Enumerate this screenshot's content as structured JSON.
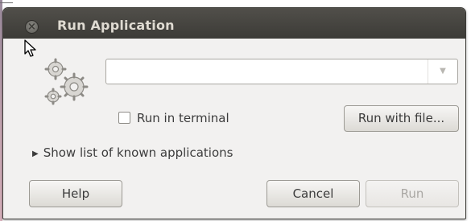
{
  "window": {
    "title": "Run Application"
  },
  "icons": {
    "close": "close-icon",
    "cursor": "mouse-pointer-icon",
    "app": "gears-icon",
    "dropdown": "chevron-down-icon",
    "expander": "triangle-right-icon"
  },
  "command_input": {
    "value": "",
    "placeholder": ""
  },
  "checkbox": {
    "label": "Run in terminal",
    "checked": false
  },
  "buttons": {
    "run_with_file": "Run with file...",
    "help": "Help",
    "cancel": "Cancel",
    "run": "Run"
  },
  "expander": {
    "label": "Show list of known applications"
  },
  "colors": {
    "titlebar": "#3c3b37",
    "title_text": "#dfdbd2",
    "dialog_bg": "#f2f1f0",
    "disabled_text": "#a9a7a3"
  }
}
